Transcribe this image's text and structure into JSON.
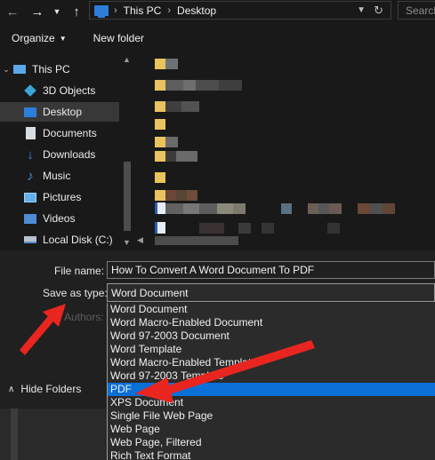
{
  "address_bar": {
    "back_icon": "arrow-left-icon",
    "forward_icon": "arrow-right-icon",
    "recent_icon": "chevron-down-icon",
    "up_icon": "arrow-up-icon",
    "crumbs": [
      "This PC",
      "Desktop"
    ],
    "refresh_icon": "refresh-icon",
    "search_placeholder": "Search"
  },
  "toolbar": {
    "organize_label": "Organize",
    "new_folder_label": "New folder"
  },
  "nav_pane": {
    "items": [
      {
        "label": "This PC",
        "icon": "computer-icon"
      },
      {
        "label": "3D Objects",
        "icon": "cube-icon"
      },
      {
        "label": "Desktop",
        "icon": "desktop-icon",
        "selected": true
      },
      {
        "label": "Documents",
        "icon": "document-icon"
      },
      {
        "label": "Downloads",
        "icon": "download-icon"
      },
      {
        "label": "Music",
        "icon": "music-note-icon"
      },
      {
        "label": "Pictures",
        "icon": "picture-icon"
      },
      {
        "label": "Videos",
        "icon": "video-icon"
      },
      {
        "label": "Local Disk (C:)",
        "icon": "drive-icon"
      }
    ]
  },
  "form": {
    "file_name_label": "File name:",
    "file_name_value": "How To Convert A Word Document To PDF",
    "save_as_type_label": "Save as type:",
    "save_as_type_value": "Word Document",
    "authors_label": "Authors:",
    "hide_folders_label": "Hide Folders"
  },
  "type_options": [
    "Word Document",
    "Word Macro-Enabled Document",
    "Word 97-2003 Document",
    "Word Template",
    "Word Macro-Enabled Template",
    "Word 97-2003 Template",
    "PDF",
    "XPS Document",
    "Single File Web Page",
    "Web Page",
    "Web Page, Filtered",
    "Rich Text Format"
  ],
  "selected_type": "PDF",
  "colors": {
    "accent_blue": "#0a6fd6",
    "annotation_red": "#e8261f",
    "folder_yellow": "#e9c35e"
  }
}
